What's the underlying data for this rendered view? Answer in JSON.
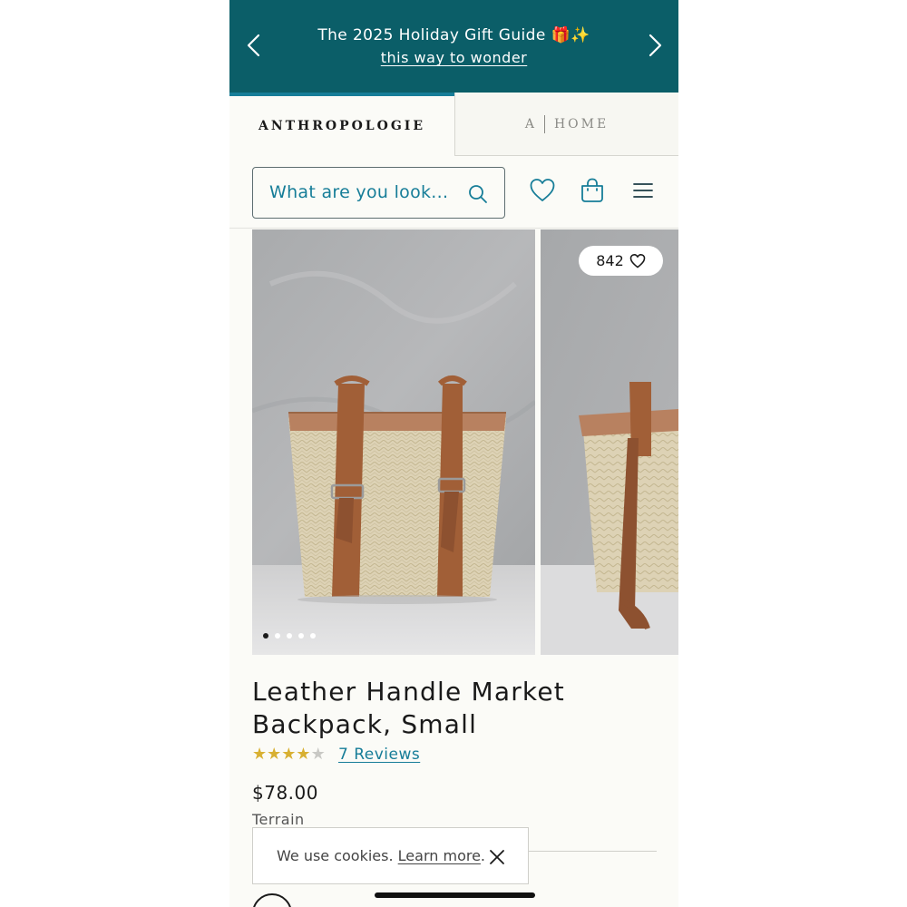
{
  "promo": {
    "title": "The 2025 Holiday Gift Guide 🎁✨",
    "link": "this way to wonder"
  },
  "tabs": {
    "anthropologie": "ANTHROPOLOGIE",
    "home_prefix": "A",
    "home": "HOME"
  },
  "search": {
    "placeholder": "What are you look..."
  },
  "gallery": {
    "favorites_count": "842",
    "dots_total": 5,
    "dots_active": 1
  },
  "product": {
    "title": "Leather Handle Market Backpack, Small",
    "rating": 4,
    "rating_max": 5,
    "reviews": "7 Reviews",
    "price": "$78.00",
    "brand": "Terrain"
  },
  "cookie": {
    "text": "We use cookies.",
    "link": "Learn more",
    "suffix": "."
  },
  "colors": {
    "banner": "#0b5e68",
    "accent": "#167d98",
    "star": "#d8b032"
  }
}
